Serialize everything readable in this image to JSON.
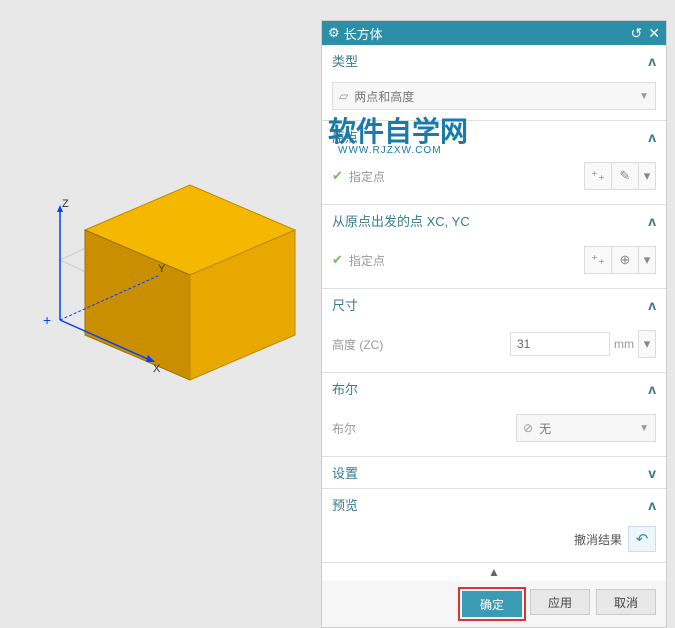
{
  "title": "长方体",
  "watermark": {
    "text": "软件自学网",
    "url": "WWW.RJZXW.COM"
  },
  "axes": {
    "x": "X",
    "y": "Y",
    "z": "Z"
  },
  "sections": {
    "type": {
      "title": "类型",
      "value": "两点和高度"
    },
    "origin": {
      "title": "原点",
      "point_label": "指定点"
    },
    "from_origin": {
      "title": "从原点出发的点 XC, YC",
      "point_label": "指定点"
    },
    "dimensions": {
      "title": "尺寸",
      "height_label": "高度 (ZC)",
      "height_value": "31",
      "height_unit": "mm"
    },
    "boolean": {
      "title": "布尔",
      "label": "布尔",
      "value": "无"
    },
    "settings": {
      "title": "设置"
    },
    "preview": {
      "title": "预览",
      "undo_label": "撤消结果"
    }
  },
  "footer": {
    "ok": "确定",
    "apply": "应用",
    "cancel": "取消"
  }
}
